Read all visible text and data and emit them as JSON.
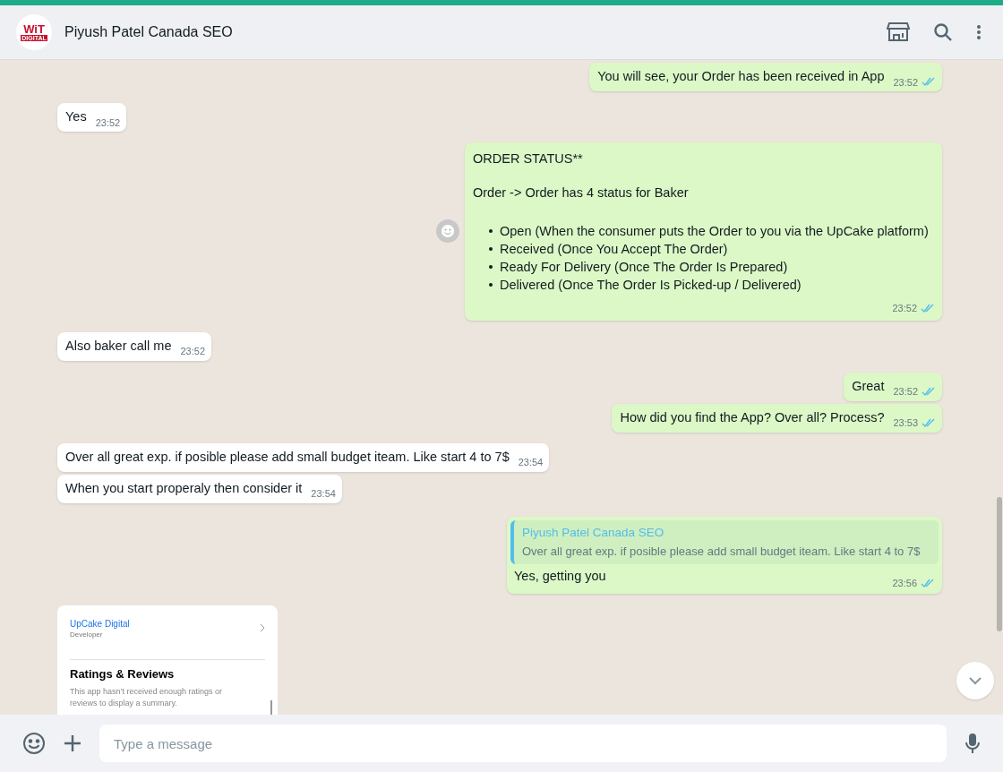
{
  "header": {
    "avatar_text": "WiT",
    "avatar_subtext": "DIGITAL",
    "title": "Piyush Patel Canada SEO"
  },
  "messages": [
    {
      "kind": "text",
      "outgoing": true,
      "text": "You will see, your Order has been received in App",
      "time": "23:52",
      "read": true
    },
    {
      "kind": "text",
      "outgoing": false,
      "text": "Yes",
      "time": "23:52"
    },
    {
      "kind": "list",
      "outgoing": true,
      "title": "ORDER STATUS**",
      "subtitle": "Order -> Order has 4 status for Baker",
      "items": [
        "Open (When the consumer puts the Order to you via the UpCake platform)",
        "Received (Once You Accept The Order)",
        "Ready For Delivery (Once The Order Is Prepared)",
        "Delivered (Once The Order Is Picked-up / Delivered)"
      ],
      "time": "23:52",
      "read": true
    },
    {
      "kind": "text",
      "outgoing": false,
      "text": "Also baker call me",
      "time": "23:52"
    },
    {
      "kind": "text",
      "outgoing": true,
      "text": "Great",
      "time": "23:52",
      "read": true
    },
    {
      "kind": "text",
      "outgoing": true,
      "text": "How did you find the App? Over all? Process?",
      "time": "23:53",
      "read": true
    },
    {
      "kind": "text",
      "outgoing": false,
      "text": "Over all great exp. if posible please add small budget iteam. Like start 4 to 7$",
      "time": "23:54"
    },
    {
      "kind": "text",
      "outgoing": false,
      "text": "When you start properaly then consider it",
      "time": "23:54"
    },
    {
      "kind": "reply",
      "outgoing": true,
      "quote_author": "Piyush Patel Canada SEO",
      "quote_text": "Over all great exp. if posible please add small budget iteam. Like start 4 to 7$",
      "text": "Yes, getting you",
      "time": "23:56",
      "read": true
    },
    {
      "kind": "screenshot",
      "outgoing": false,
      "developer_name": "UpCake Digital",
      "developer_label": "Developer",
      "section_title": "Ratings & Reviews",
      "section_text": "This app hasn’t received enough ratings or reviews to display a summary."
    }
  ],
  "composer": {
    "placeholder": "Type a message"
  }
}
